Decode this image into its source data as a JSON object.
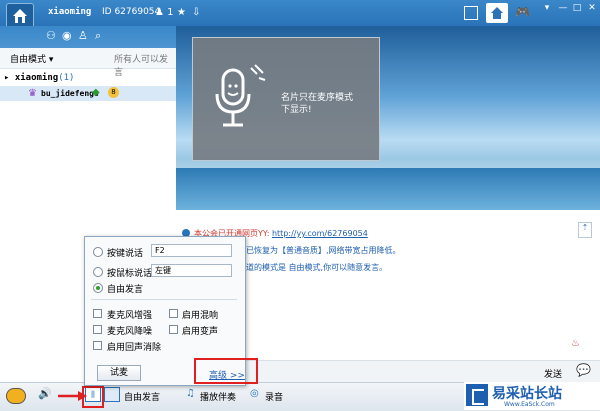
{
  "header": {
    "username": "xiaoming",
    "id_text": "ID 62769054",
    "user_count": "1"
  },
  "left_panel": {
    "mode_label": "自由模式",
    "mode_desc": "所有人可以发言",
    "channel_name": "xiaoming",
    "channel_count": "(1)",
    "member_name": "bu_jidefengs"
  },
  "banner": {
    "line1": "名片只在麦序模式",
    "line2": "下显示!"
  },
  "chat": {
    "notice_prefix": "本公会已开通网页YY:",
    "notice_link": "http://yy.com/62769054",
    "line2": "已恢复为【普通音质】,网络带宽占用降低。",
    "line3": "道的模式是 自由模式,你可以随意发言。"
  },
  "popup": {
    "radio1": "按键说话",
    "radio1_value": "F2",
    "radio2": "按鼠标说话",
    "radio2_value": "左键",
    "radio3": "自由发言",
    "chk1": "麦克风增强",
    "chk2": "启用混响",
    "chk3": "麦克风降噪",
    "chk4": "启用变声",
    "chk5": "启用回声消除",
    "test_button": "试麦",
    "advanced_link": "高级 >>"
  },
  "send_bar": {
    "send_label": "发送"
  },
  "bottom_bar": {
    "free_speak": "自由发言",
    "play_music": "播放伴奏",
    "record": "录音"
  },
  "watermark": {
    "title": "易采站长站",
    "url": "Www.EaSck.Com"
  },
  "colors": {
    "accent": "#2a73b8",
    "highlight_red": "#e02020",
    "notice_red": "#d33a2f",
    "link_blue": "#1f5fb0"
  }
}
